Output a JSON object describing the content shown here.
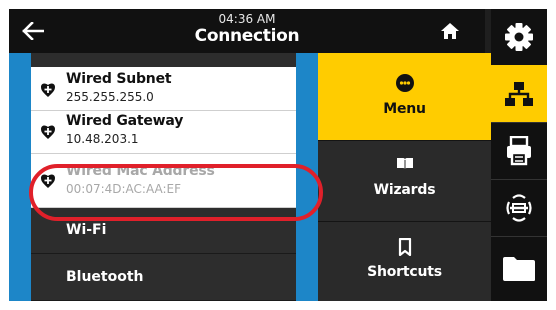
{
  "header": {
    "time": "04:36 AM",
    "title": "Connection",
    "back_icon": "arrow-left-icon",
    "home_icon": "home-icon"
  },
  "list": {
    "items": [
      {
        "label": "Wired Subnet",
        "value": "255.255.255.0",
        "enabled": true
      },
      {
        "label": "Wired Gateway",
        "value": "10.48.203.1",
        "enabled": true
      },
      {
        "label": "Wired Mac Address",
        "value": "00:07:4D:AC:AA:EF",
        "enabled": false
      }
    ],
    "submenus": [
      {
        "label": "Wi-Fi"
      },
      {
        "label": "Bluetooth"
      }
    ]
  },
  "menu": {
    "items": [
      {
        "label": "Menu",
        "icon": "menu-dots-icon",
        "active": true
      },
      {
        "label": "Wizards",
        "icon": "book-icon",
        "active": false
      },
      {
        "label": "Shortcuts",
        "icon": "bookmark-icon",
        "active": false
      }
    ]
  },
  "rail": {
    "items": [
      {
        "icon": "gear-icon",
        "active": false
      },
      {
        "icon": "network-icon",
        "active": true
      },
      {
        "icon": "printer-icon",
        "active": false
      },
      {
        "icon": "rfid-icon",
        "active": false
      },
      {
        "icon": "folder-icon",
        "active": false
      }
    ]
  },
  "colors": {
    "accent": "#ffcc00",
    "list_border": "#1d86c8",
    "highlight": "#e0202a",
    "background": "#1f1f1f"
  }
}
